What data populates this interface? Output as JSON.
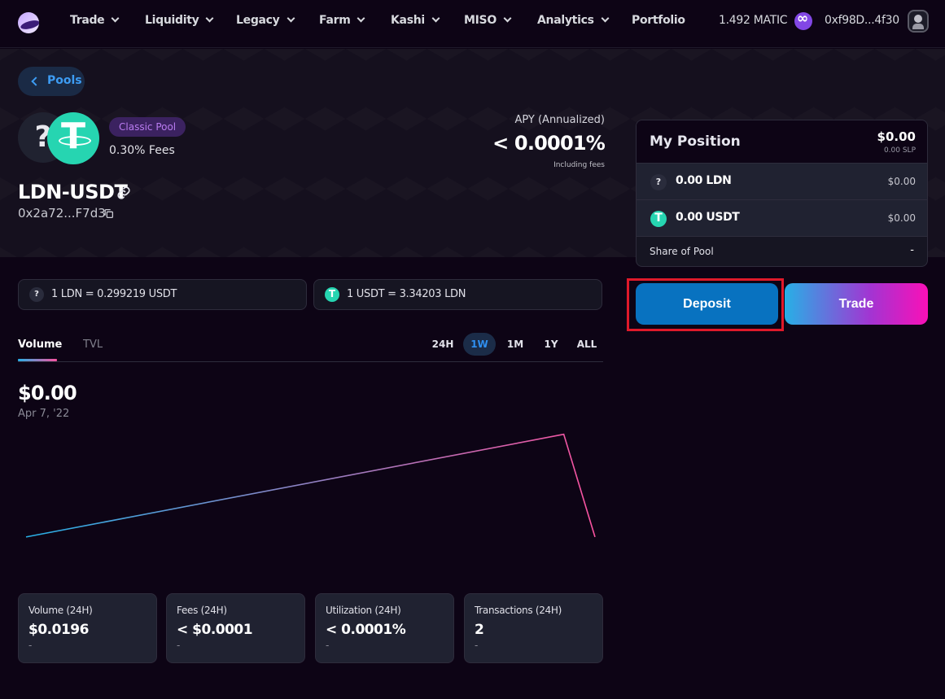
{
  "nav": {
    "items": [
      {
        "label": "Trade",
        "dropdown": true
      },
      {
        "label": "Liquidity",
        "dropdown": true
      },
      {
        "label": "Legacy",
        "dropdown": true
      },
      {
        "label": "Farm",
        "dropdown": true
      },
      {
        "label": "Kashi",
        "dropdown": true
      },
      {
        "label": "MISO",
        "dropdown": true
      },
      {
        "label": "Analytics",
        "dropdown": true
      },
      {
        "label": "Portfolio",
        "dropdown": false
      }
    ],
    "balance": "1.492 MATIC",
    "wallet": "0xf98D...4f30"
  },
  "back_label": "Pools",
  "pool": {
    "badge": "Classic Pool",
    "fees": "0.30% Fees",
    "pair": "LDN-USDT",
    "address": "0x2a72...F7d3",
    "token0_symbol": "?",
    "apy_label": "APY (Annualized)",
    "apy_value": "< 0.0001%",
    "apy_note": "Including fees"
  },
  "position": {
    "title": "My Position",
    "usd": "$0.00",
    "slp": "0.00 SLP",
    "rows": [
      {
        "icon": "unknown-token-icon",
        "symbol": "?",
        "amount": "0.00 LDN",
        "usd": "$0.00"
      },
      {
        "icon": "usdt-token-icon",
        "symbol": "T",
        "amount": "0.00 USDT",
        "usd": "$0.00"
      }
    ],
    "share_label": "Share of Pool",
    "share_value": "-"
  },
  "actions": {
    "deposit": "Deposit",
    "trade": "Trade"
  },
  "rates": [
    {
      "symbol": "?",
      "text": "1 LDN = 0.299219 USDT"
    },
    {
      "symbol": "T",
      "text": "1 USDT = 3.34203 LDN"
    }
  ],
  "chart_tabs": [
    {
      "label": "Volume",
      "active": true
    },
    {
      "label": "TVL",
      "active": false
    }
  ],
  "ranges": [
    {
      "label": "24H",
      "active": false
    },
    {
      "label": "1W",
      "active": true
    },
    {
      "label": "1M",
      "active": false
    },
    {
      "label": "1Y",
      "active": false
    },
    {
      "label": "ALL",
      "active": false
    }
  ],
  "chart_value": "$0.00",
  "chart_date": "Apr 7, '22",
  "chart_data": {
    "type": "line",
    "x": [
      0,
      1,
      2
    ],
    "values": [
      0.06,
      1.0,
      0.06
    ],
    "ylim": [
      0,
      1.05
    ],
    "gradient": [
      "#27b0e6",
      "#fa52a0"
    ]
  },
  "stats": [
    {
      "label": "Volume (24H)",
      "value": "$0.0196",
      "change": "-"
    },
    {
      "label": "Fees (24H)",
      "value": "< $0.0001",
      "change": "-"
    },
    {
      "label": "Utilization (24H)",
      "value": "< 0.0001%",
      "change": "-"
    },
    {
      "label": "Transactions (24H)",
      "value": "2",
      "change": "-"
    }
  ],
  "colors": {
    "accent_blue": "#0872c0",
    "usdt_green": "#26d5b1",
    "badge_purple": "#b97bf0",
    "highlight_red": "#e0192a"
  }
}
